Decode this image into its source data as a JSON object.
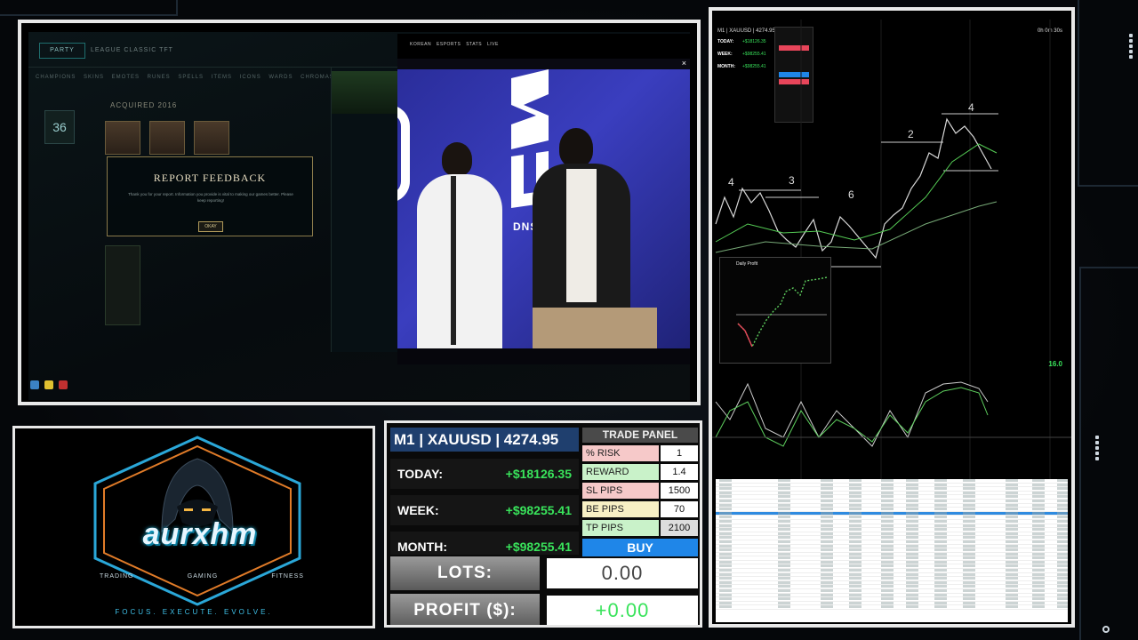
{
  "game_window": {
    "party_label": "PARTY",
    "nav": "LEAGUE  CLASSIC  TFT",
    "subnav": "CHAMPIONS SKINS EMOTES RUNES SPELLS ITEMS ICONS WARDS CHROMAS ETERNALS",
    "icons_count": "36",
    "acquired_label": "ACQUIRED 2016",
    "report_title": "REPORT FEEDBACK",
    "report_body": "Thank you for your report. Information you provide is vital to making our games better. Please keep reporting!",
    "report_button": "OKAY"
  },
  "video": {
    "nav": "KOREAN ESPORTS  STATS  LIVE",
    "brand": "DNS"
  },
  "brand": {
    "name": "aurxhm",
    "pillars": [
      "TRADING",
      "GAMING",
      "FITNESS"
    ],
    "tagline": "FOCUS. EXECUTE. EVOLVE."
  },
  "stats": {
    "header": "M1 | XAUUSD | 4274.95",
    "rows": [
      {
        "label": "TODAY:",
        "value": "+$18126.35"
      },
      {
        "label": "WEEK:",
        "value": "+$98255.41"
      },
      {
        "label": "MONTH:",
        "value": "+$98255.41"
      }
    ],
    "lots_label": "LOTS:",
    "lots_value": "0.00",
    "profit_label": "PROFIT ($):",
    "profit_value": "+0.00"
  },
  "trade_panel": {
    "title": "TRADE PANEL",
    "rows": [
      {
        "label": "% RISK",
        "value": "1",
        "color": "#f6c9c9"
      },
      {
        "label": "REWARD",
        "value": "1.4",
        "color": "#c9f2c9"
      },
      {
        "label": "SL PIPS",
        "value": "1500",
        "color": "#f6c9c9"
      },
      {
        "label": "BE PIPS",
        "value": "70",
        "color": "#f7f0c4"
      },
      {
        "label": "TP PIPS",
        "value": "2100",
        "color": "#c9f2c9"
      }
    ],
    "buy_label": "BUY"
  },
  "chart": {
    "title": "M1 | XAUUSD | 4274.95",
    "timer": "0h 0m 30s",
    "mini_rows": [
      {
        "label": "TODAY:",
        "value": "+$18126.35"
      },
      {
        "label": "WEEK:",
        "value": "+$98255.41"
      },
      {
        "label": "MONTH:",
        "value": "+$98255.41"
      }
    ],
    "daily_profit_title": "Daily Profit",
    "level_label": "16.0",
    "waves": [
      "4",
      "3",
      "6",
      "2",
      "4"
    ]
  },
  "colors": {
    "profit_green": "#39e35b",
    "buy_blue": "#1f86e8",
    "header_blue": "#1f3f6e",
    "brand_cyan": "#3fc0e8"
  }
}
